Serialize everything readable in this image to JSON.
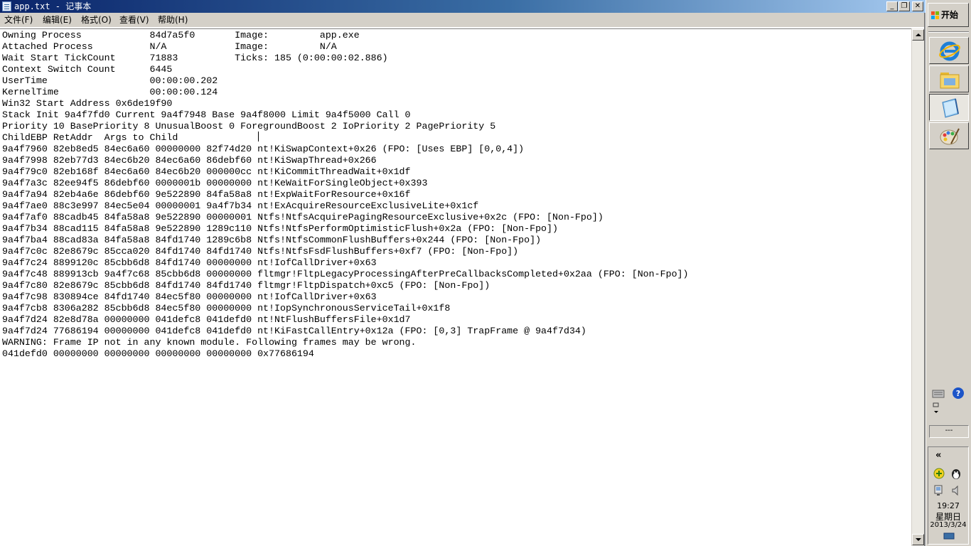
{
  "window": {
    "title": "app.txt - 记事本",
    "buttons": {
      "minimize": "_",
      "maximize": "❐",
      "close": "✕"
    }
  },
  "menu": [
    {
      "label": "文件(F)"
    },
    {
      "label": "编辑(E)"
    },
    {
      "label": "格式(O)"
    },
    {
      "label": "查看(V)"
    },
    {
      "label": "帮助(H)"
    }
  ],
  "document": {
    "lines": [
      "Owning Process            84d7a5f0       Image:         app.exe",
      "Attached Process          N/A            Image:         N/A",
      "Wait Start TickCount      71883          Ticks: 185 (0:00:00:02.886)",
      "Context Switch Count      6445",
      "UserTime                  00:00:00.202",
      "KernelTime                00:00:00.124",
      "Win32 Start Address 0x6de19f90",
      "Stack Init 9a4f7fd0 Current 9a4f7948 Base 9a4f8000 Limit 9a4f5000 Call 0",
      "Priority 10 BasePriority 8 UnusualBoost 0 ForegroundBoost 2 IoPriority 2 PagePriority 5",
      "ChildEBP RetAddr  Args to Child",
      "9a4f7960 82eb8ed5 84ec6a60 00000000 82f74d20 nt!KiSwapContext+0x26 (FPO: [Uses EBP] [0,0,4])",
      "9a4f7998 82eb77d3 84ec6b20 84ec6a60 86debf60 nt!KiSwapThread+0x266",
      "9a4f79c0 82eb168f 84ec6a60 84ec6b20 000000cc nt!KiCommitThreadWait+0x1df",
      "9a4f7a3c 82ee94f5 86debf60 0000001b 00000000 nt!KeWaitForSingleObject+0x393",
      "9a4f7a94 82eb4a6e 86debf60 9e522890 84fa58a8 nt!ExpWaitForResource+0x16f",
      "9a4f7ae0 88c3e997 84ec5e04 00000001 9a4f7b34 nt!ExAcquireResourceExclusiveLite+0x1cf",
      "9a4f7af0 88cadb45 84fa58a8 9e522890 00000001 Ntfs!NtfsAcquirePagingResourceExclusive+0x2c (FPO: [Non-Fpo])",
      "9a4f7b34 88cad115 84fa58a8 9e522890 1289c110 Ntfs!NtfsPerformOptimisticFlush+0x2a (FPO: [Non-Fpo])",
      "9a4f7ba4 88cad83a 84fa58a8 84fd1740 1289c6b8 Ntfs!NtfsCommonFlushBuffers+0x244 (FPO: [Non-Fpo])",
      "9a4f7c0c 82e8679c 85cca020 84fd1740 84fd1740 Ntfs!NtfsFsdFlushBuffers+0xf7 (FPO: [Non-Fpo])",
      "9a4f7c24 8899120c 85cbb6d8 84fd1740 00000000 nt!IofCallDriver+0x63",
      "9a4f7c48 889913cb 9a4f7c68 85cbb6d8 00000000 fltmgr!FltpLegacyProcessingAfterPreCallbacksCompleted+0x2aa (FPO: [Non-Fpo])",
      "9a4f7c80 82e8679c 85cbb6d8 84fd1740 84fd1740 fltmgr!FltpDispatch+0xc5 (FPO: [Non-Fpo])",
      "9a4f7c98 830894ce 84fd1740 84ec5f80 00000000 nt!IofCallDriver+0x63",
      "9a4f7cb8 8306a282 85cbb6d8 84ec5f80 00000000 nt!IopSynchronousServiceTail+0x1f8",
      "9a4f7d24 82e8d78a 00000000 041defc8 041defd0 nt!NtFlushBuffersFile+0x1d7",
      "9a4f7d24 77686194 00000000 041defc8 041defd0 nt!KiFastCallEntry+0x12a (FPO: [0,3] TrapFrame @ 9a4f7d34)",
      "WARNING: Frame IP not in any known module. Following frames may be wrong.",
      "041defd0 00000000 00000000 00000000 00000000 0x77686194"
    ]
  },
  "taskbar": {
    "start_label": "开始",
    "quicklaunch": [
      {
        "name": "internet-explorer-icon"
      },
      {
        "name": "folder-icon"
      },
      {
        "name": "notepad-icon"
      },
      {
        "name": "paint-icon"
      }
    ],
    "tray_dashes": "---",
    "clock": {
      "time": "19:27",
      "day": "星期日",
      "date": "2013/3/24"
    }
  },
  "colors": {
    "title_active_start": "#0a246a",
    "title_active_end": "#a6caf0",
    "chrome": "#d4d0c8"
  }
}
